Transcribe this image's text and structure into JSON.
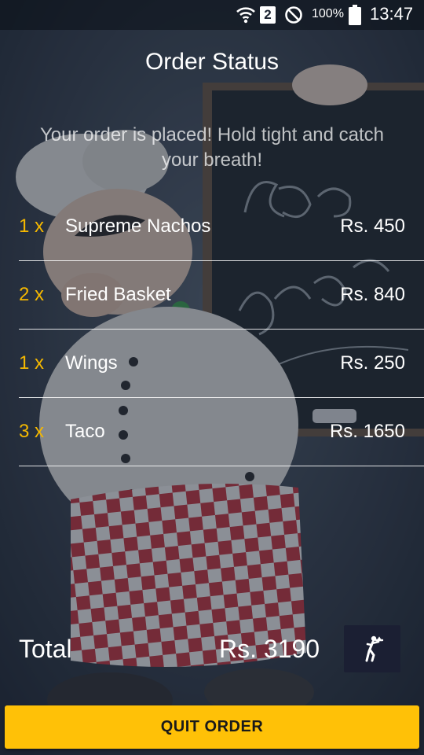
{
  "status_bar": {
    "sim_slot": "2",
    "battery_percent": "100%",
    "time": "13:47",
    "icons": [
      "wifi-icon",
      "sim-icon",
      "do-not-disturb-icon",
      "battery-icon"
    ]
  },
  "header": {
    "title": "Order Status",
    "message": "Your order is placed! Hold tight and catch your breath!"
  },
  "order": {
    "items": [
      {
        "qty": "1 x",
        "name": "Supreme Nachos",
        "price": "Rs. 450"
      },
      {
        "qty": "2 x",
        "name": "Fried Basket",
        "price": "Rs. 840"
      },
      {
        "qty": "1 x",
        "name": "Wings",
        "price": "Rs. 250"
      },
      {
        "qty": "3 x",
        "name": "Taco",
        "price": "Rs. 1650"
      }
    ]
  },
  "summary": {
    "total_label": "Total",
    "total_value": "Rs. 3190",
    "call_waiter_icon": "waiter-icon"
  },
  "actions": {
    "quit_label": "QUIT ORDER"
  },
  "colors": {
    "accent": "#ffc107",
    "quantity": "#f5b800",
    "call_button": "#1b1f33"
  }
}
